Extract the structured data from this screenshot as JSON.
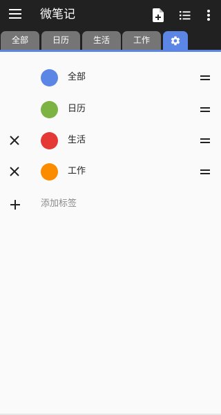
{
  "app": {
    "title": "微笔记"
  },
  "tabs": [
    {
      "label": "全部"
    },
    {
      "label": "日历"
    },
    {
      "label": "生活"
    },
    {
      "label": "工作"
    }
  ],
  "tag_list": {
    "items": [
      {
        "name": "全部",
        "color": "#5b86e5",
        "deletable": false
      },
      {
        "name": "日历",
        "color": "#7cb342",
        "deletable": false
      },
      {
        "name": "生活",
        "color": "#e53935",
        "deletable": true
      },
      {
        "name": "工作",
        "color": "#fb8c00",
        "deletable": true
      }
    ],
    "add_label": "添加标签"
  },
  "icons": {
    "menu": "menu-icon",
    "new_note": "new-note-icon",
    "list": "list-view-icon",
    "more": "more-vert-icon",
    "settings": "gear-icon",
    "delete": "close-icon",
    "drag": "drag-handle-icon",
    "add": "plus-icon"
  },
  "colors": {
    "appbar": "#212121",
    "tab_inactive": "#757575",
    "accent": "#5b86e5",
    "background": "#fafafa"
  }
}
